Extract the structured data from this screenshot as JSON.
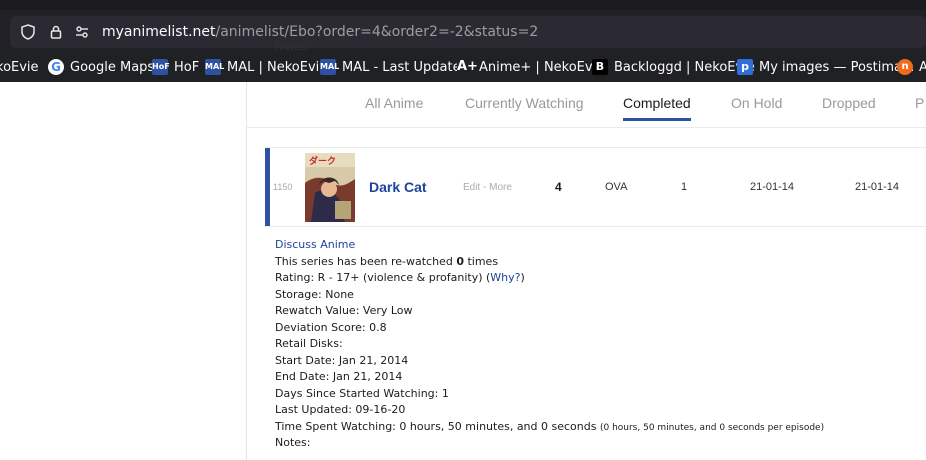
{
  "browser": {
    "url_host": "myanimelist.net",
    "url_path": "/animelist/Ebo?order=4&order2=-2&status=2",
    "bookmarks": [
      {
        "label": "koEvie",
        "icon": "partial-site-icon",
        "color": "#202124"
      },
      {
        "label": "Google Maps",
        "icon": "google-icon",
        "color": "#ffffff"
      },
      {
        "label": "HoF",
        "icon": "hof-icon",
        "color": "#2e51a2"
      },
      {
        "label": "MAL | NekoEvie",
        "icon": "mal-icon",
        "color": "#2e51a2"
      },
      {
        "label": "MAL - Last Updated",
        "icon": "mal-icon",
        "color": "#2e51a2"
      },
      {
        "label": "Anime+ | NekoEvie",
        "icon": "anime-plus-icon",
        "color": "#000000"
      },
      {
        "label": "Backloggd | NekoEvie",
        "icon": "backloggd-icon",
        "color": "#000000"
      },
      {
        "label": "My images — Postima...",
        "icon": "postimages-icon",
        "color": "#2f6fd6"
      },
      {
        "label": "A",
        "icon": "orange-site-icon",
        "color": "#f26b1d"
      }
    ]
  },
  "nav": {
    "tabs": [
      {
        "label": "All Anime",
        "active": false
      },
      {
        "label": "Currently Watching",
        "active": false
      },
      {
        "label": "Completed",
        "active": true
      },
      {
        "label": "On Hold",
        "active": false
      },
      {
        "label": "Dropped",
        "active": false
      },
      {
        "label": "P",
        "active": false
      }
    ]
  },
  "list": {
    "notes_label_top": "Notes:",
    "entry": {
      "number": "1150",
      "title": "Dark Cat",
      "edit": "Edit",
      "sep": " - ",
      "more": "More",
      "score": "4",
      "type": "OVA",
      "progress": "1",
      "start_date": "21-01-14",
      "finish_date": "21-01-14"
    }
  },
  "details": {
    "discuss": "Discuss Anime",
    "rewatched_pre": "This series has been re-watched ",
    "rewatched_count": "0",
    "rewatched_post": " times",
    "rating_pre": "Rating: R - 17+ (violence & profanity) (",
    "rating_why": "Why?",
    "rating_post": ")",
    "storage": "Storage: None",
    "rewatch_value": "Rewatch Value: Very Low",
    "deviation": "Deviation Score: 0.8",
    "retail": "Retail Disks:",
    "start": "Start Date: Jan 21, 2014",
    "end": "End Date: Jan 21, 2014",
    "days": "Days Since Started Watching: 1",
    "updated": "Last Updated: 09-16-20",
    "time_spent": "Time Spent Watching: 0 hours, 50 minutes, and 0 seconds ",
    "time_per_ep": "(0 hours, 50 minutes, and 0 seconds per episode)",
    "notes": "Notes:"
  }
}
